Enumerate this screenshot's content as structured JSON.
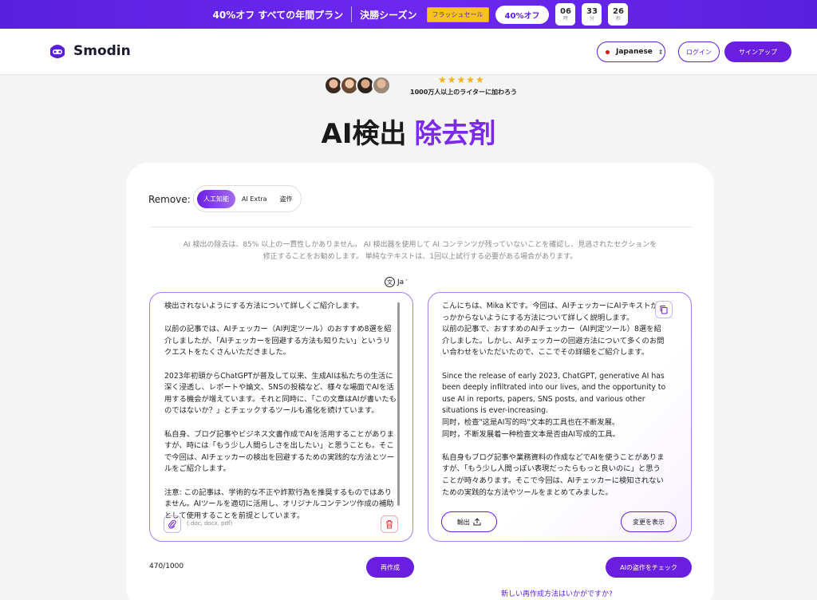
{
  "promo": {
    "text": "40%オフ すべての年間プラン",
    "season": "決勝シーズン",
    "flash": "フラッシュセール",
    "discount": "40%オフ",
    "countdown": [
      {
        "value": "06",
        "unit": "時"
      },
      {
        "value": "33",
        "unit": "分"
      },
      {
        "value": "26",
        "unit": "秒"
      }
    ]
  },
  "header": {
    "brand": "Smodin",
    "language": "Japanese",
    "login": "ログイン",
    "signup": "サインアップ"
  },
  "hero": {
    "stars": "★★★★★",
    "joined": "1000万人以上のライターに加わろう",
    "title_main": "AI検出",
    "title_accent": "除去剤"
  },
  "remove": {
    "label": "Remove:",
    "options": [
      "人工知能",
      "AI Extra",
      "盗作"
    ]
  },
  "notice": "AI 検出の除去は、85% 以上の一貫性しかありません。 AI 検出器を使用して AI コンテンツが残っていないことを確認し、見逃されたセクションを修正することをお勧めします。 単純なテキストは、1回以上試行する必要がある場合があります。",
  "lang_toggle": "Ja",
  "input": {
    "text": "検出されないようにする方法について詳しくご紹介します。\n\n以前の記事では、AIチェッカー（AI判定ツール）のおすすめ8選を紹介しましたが、「AIチェッカーを回避する方法も知りたい」というリクエストをたくさんいただきました。\n\n2023年初頭からChatGPTが普及して以来、生成AIは私たちの生活に深く浸透し、レポートや論文、SNSの投稿など、様々な場面でAIを活用する機会が増えています。それと同時に、「この文章はAIが書いたものではないか？」とチェックするツールも進化を続けています。\n\n私自身、ブログ記事やビジネス文書作成でAIを活用することがありますが、時には「もう少し人間らしさを出したい」と思うことも。そこで今回は、AIチェッカーの検出を回避するための実践的な方法とツールをご紹介します。\n\n注意: この記事は、学術的な不正や詐欺行為を推奨するものではありません。AIツールを適切に活用し、オリジナルコンテンツ作成の補助として使用することを前提としています。",
    "file_types": "(.doc, docx, pdf)"
  },
  "output": {
    "text": "こんにちは、Mika Kです。今回は、AIチェッカーにAIテキストが引っかからないようにする方法について詳しく説明します。\n以前の記事で、おすすめのAIチェッカー（AI判定ツール）8選を紹介しました。しかし、AIチェッカーの回避方法について多くのお問い合わせをいただいたので、ここでその詳細をご紹介します。\n\nSince the release of early 2023, ChatGPT, generative AI has been deeply infiltrated into our lives, and the opportunity to use AI in reports, papers, SNS posts, and various other situations is ever-increasing.\n同时，检查\"这是AI写的吗\"文本的工具也在不断发展。\n同时，不断发展着一种检查文本是否由AI写成的工具。\n\n私自身もブログ記事や業務資料の作成などでAIを使うことがありますが、「もう少し人間っぽい表現だったらもっと良いのに」と思うことが時々あります。そこで今回は、AIチェッカーに検知されないための実践的な方法やツールをまとめてみました。",
    "export": "輸出",
    "show_changes": "変更を表示"
  },
  "footer": {
    "count": "470/1000",
    "rewrite": "再作成",
    "check_ai": "AIの盗作をチェック",
    "new_way": "新しい再作成方法はいかがですか?"
  },
  "colors": {
    "accent": "#6a1fe0",
    "accent_light": "#a77bf0",
    "promo_bg": "#5a1fe0",
    "star": "#f2b01e",
    "danger": "#e53935"
  }
}
